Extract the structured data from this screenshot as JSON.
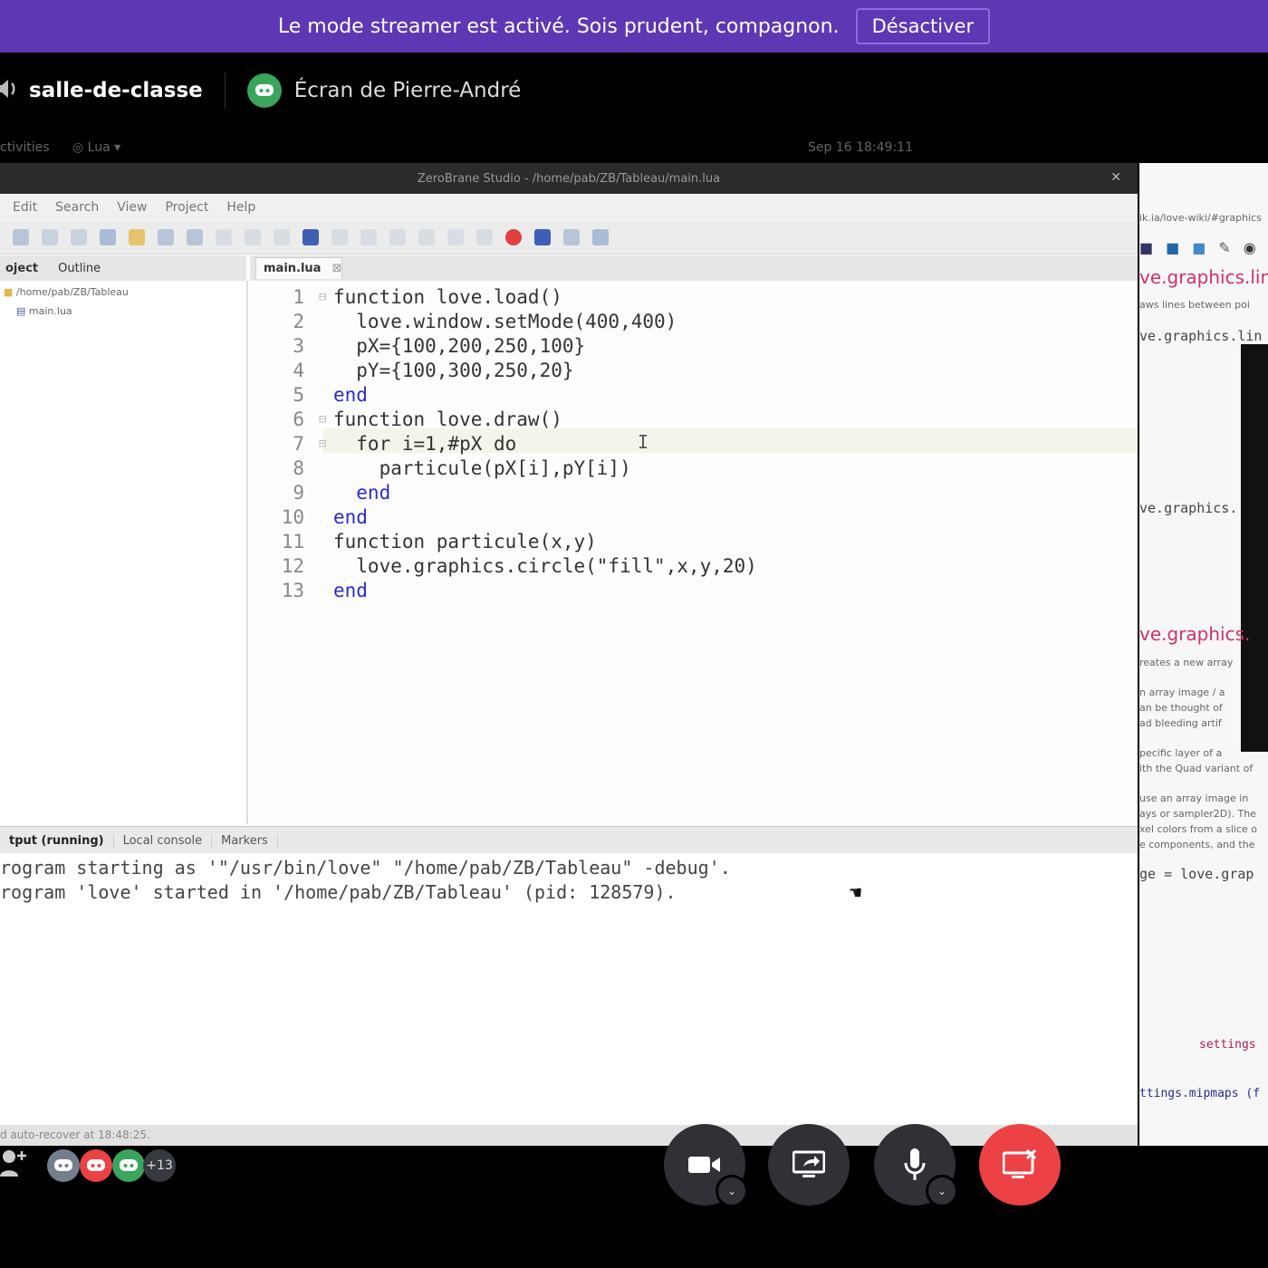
{
  "banner": {
    "message": "Le mode streamer est activé. Sois prudent, compagnon.",
    "button": "Désactiver"
  },
  "header": {
    "channel": "salle-de-classe",
    "screen_title": "Écran de Pierre-André",
    "activities": "ctivities",
    "app_menu": "Lua",
    "clock": "Sep 16 18:49:11"
  },
  "ide": {
    "title": "ZeroBrane Studio - /home/pab/ZB/Tableau/main.lua",
    "menu": [
      "Edit",
      "Search",
      "View",
      "Project",
      "Help"
    ],
    "left_tabs": [
      "oject",
      "Outline"
    ],
    "tree": {
      "folder": "/home/pab/ZB/Tableau",
      "file": "main.lua"
    },
    "editor_tab": "main.lua",
    "code_lines": [
      "function love.load()",
      "  love.window.setMode(400,400)",
      "  pX={100,200,250,100}",
      "  pY={100,300,250,20}",
      "end",
      "function love.draw()",
      "  for i=1,#pX do",
      "    particule(pX[i],pY[i])",
      "  end",
      "end",
      "function particule(x,y)",
      "  love.graphics.circle(\"fill\",x,y,20)",
      "end"
    ],
    "output_tabs": [
      "tput (running)",
      "Local console",
      "Markers"
    ],
    "output_lines": [
      "rogram starting as '\"/usr/bin/love\" \"/home/pab/ZB/Tableau\" -debug'.",
      "rogram 'love' started in '/home/pab/ZB/Tableau' (pid: 128579)."
    ],
    "status_text": "d auto-recover at 18:48:25."
  },
  "right_window": {
    "url": "ik.ia/love-wiki/#graphics",
    "heading1": "ve.graphics.lin",
    "desc1": "aws lines between poi",
    "code1": "ve.graphics.lin",
    "code2": "ve.graphics.",
    "heading2": "ve.graphics.",
    "desc_lines": [
      "reates a new array",
      "n array image / a",
      "an be thought of",
      "ad bleeding artif",
      "pecific layer of a",
      "ith the Quad variant of",
      "use an array image in",
      "ays or sampler2D). The",
      "xel colors from a slice o",
      "e components, and the"
    ],
    "code3": "ge = love.grap",
    "code4": "settings",
    "code5": "ttings.mipmaps (f"
  },
  "bottom": {
    "extra_members": "+13"
  },
  "colors": {
    "banner": "#5e37b4",
    "discord_green": "#3ba55d",
    "discord_red": "#ed4245",
    "keyword": "#2a2ad0"
  }
}
